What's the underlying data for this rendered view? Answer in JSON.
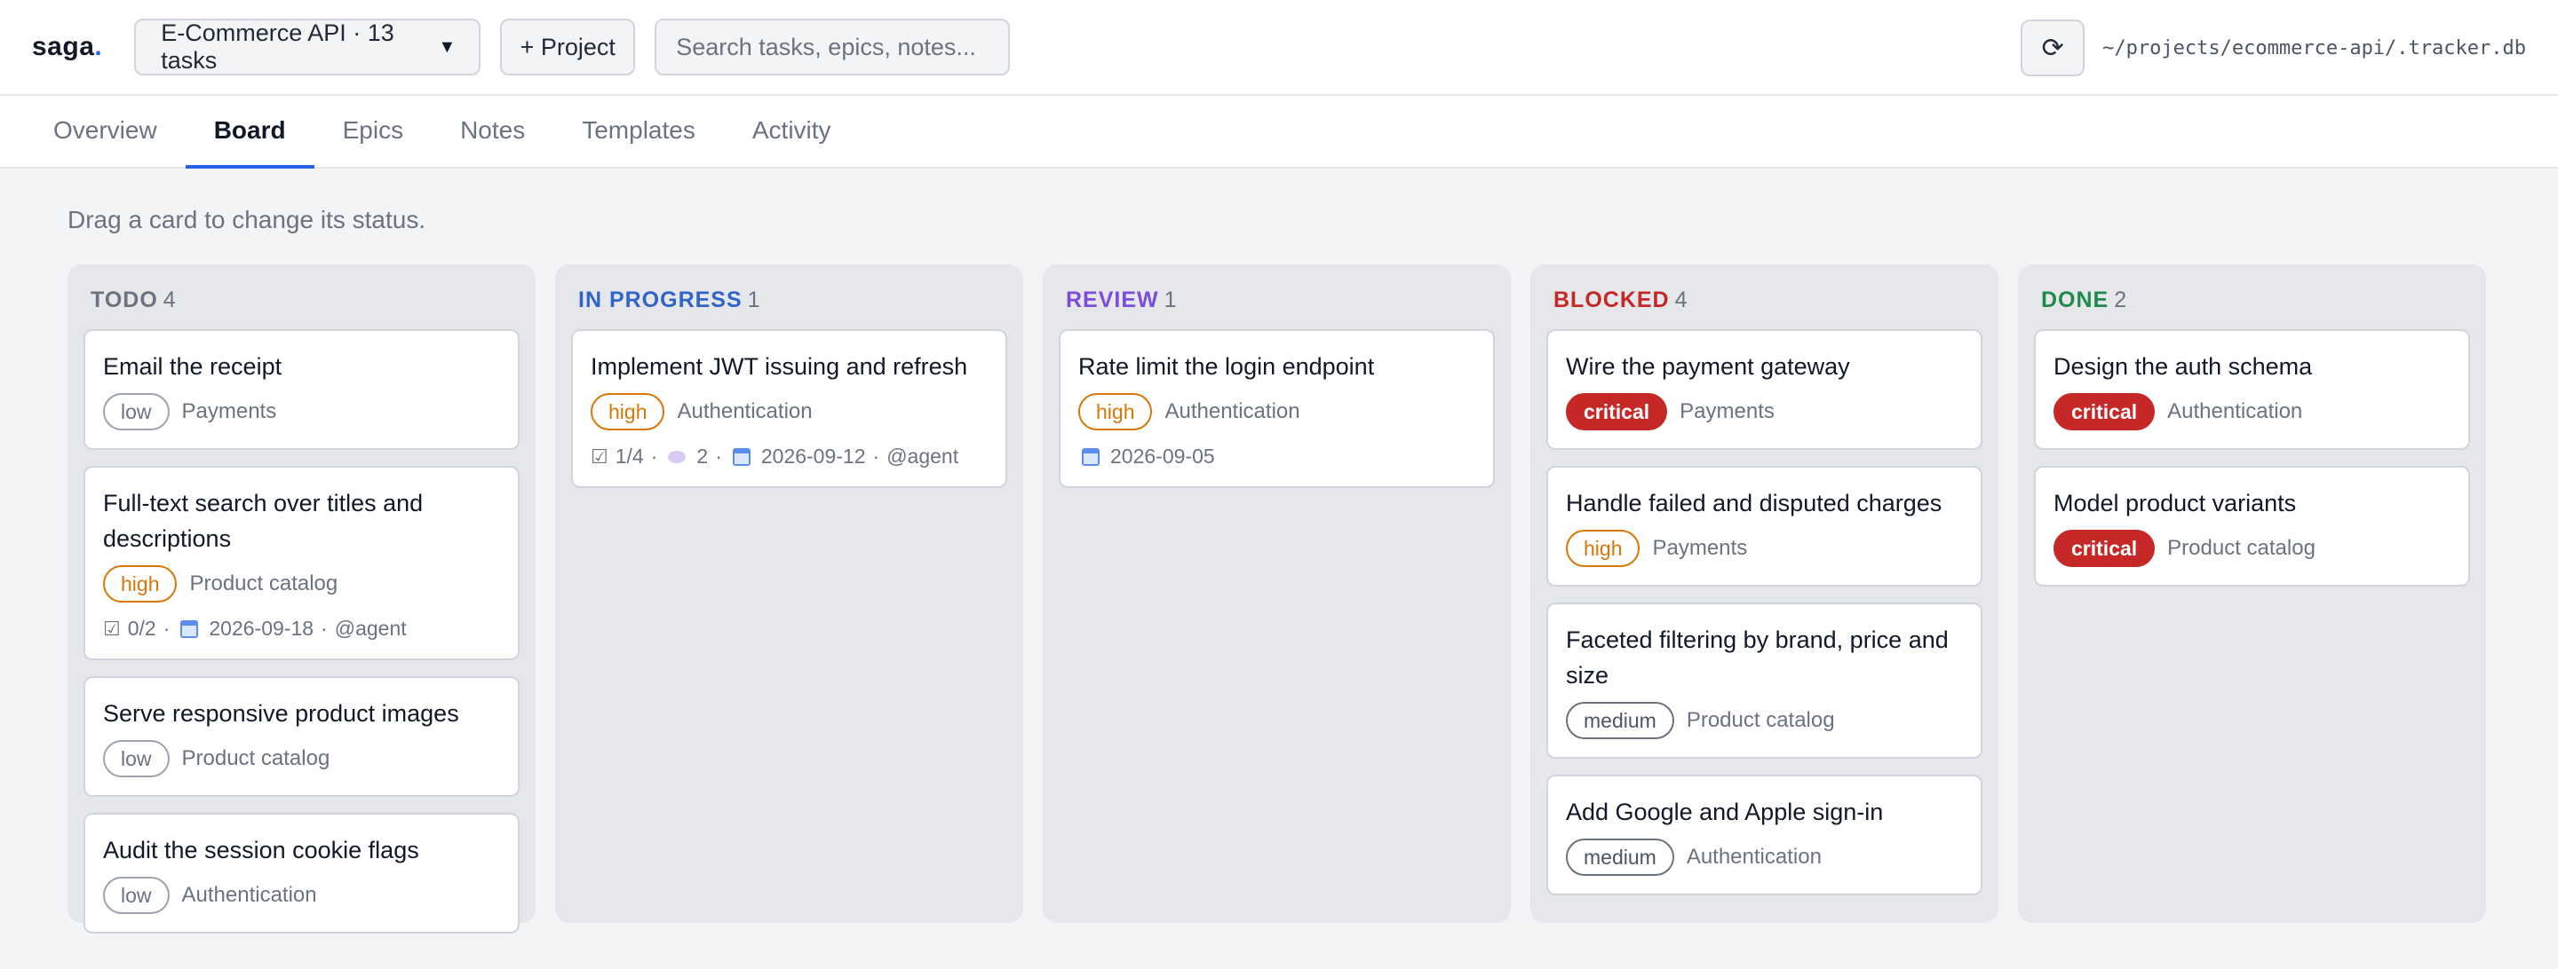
{
  "app": {
    "logo": "saga",
    "logo_dot": ".",
    "project_select": "E-Commerce API · 13 tasks",
    "new_project": "+ Project",
    "search_placeholder": "Search tasks, epics, notes...",
    "refresh_icon": "⟳",
    "db_path": "~/projects/ecommerce-api/.tracker.db"
  },
  "tabs": [
    {
      "label": "Overview"
    },
    {
      "label": "Board",
      "active": true
    },
    {
      "label": "Epics"
    },
    {
      "label": "Notes"
    },
    {
      "label": "Templates"
    },
    {
      "label": "Activity"
    }
  ],
  "hint": "Drag a card to change its status.",
  "colors": {
    "todo": "#6b7280",
    "in_progress": "#2f64c8",
    "review": "#7c4ddb",
    "blocked": "#c62828",
    "done": "#1f8a4c"
  },
  "columns": [
    {
      "title": "TODO",
      "count": "4",
      "cards": [
        {
          "title": "Email the receipt",
          "priority": "low",
          "epic": "Payments"
        },
        {
          "title": "Full-text search over titles and descriptions",
          "priority": "high",
          "epic": "Product catalog",
          "meta": {
            "checks": "0/2",
            "sep1": "·",
            "date": "2026-09-18",
            "sep2": "·",
            "assignee": "@agent"
          }
        },
        {
          "title": "Serve responsive product images",
          "priority": "low",
          "epic": "Product catalog"
        },
        {
          "title": "Audit the session cookie flags",
          "priority": "low",
          "epic": "Authentication"
        }
      ]
    },
    {
      "title": "IN PROGRESS",
      "count": "1",
      "cards": [
        {
          "title": "Implement JWT issuing and refresh",
          "priority": "high",
          "epic": "Authentication",
          "meta": {
            "checks": "1/4",
            "sep1": "·",
            "comments": "2",
            "sep2": "·",
            "date": "2026-09-12",
            "sep3": "·",
            "assignee": "@agent"
          }
        }
      ]
    },
    {
      "title": "REVIEW",
      "count": "1",
      "cards": [
        {
          "title": "Rate limit the login endpoint",
          "priority": "high",
          "epic": "Authentication",
          "meta": {
            "date": "2026-09-05"
          }
        }
      ]
    },
    {
      "title": "BLOCKED",
      "count": "4",
      "cards": [
        {
          "title": "Wire the payment gateway",
          "priority": "critical",
          "epic": "Payments"
        },
        {
          "title": "Handle failed and disputed charges",
          "priority": "high",
          "epic": "Payments"
        },
        {
          "title": "Faceted filtering by brand, price and size",
          "priority": "medium",
          "epic": "Product catalog"
        },
        {
          "title": "Add Google and Apple sign-in",
          "priority": "medium",
          "epic": "Authentication"
        }
      ]
    },
    {
      "title": "DONE",
      "count": "2",
      "cards": [
        {
          "title": "Design the auth schema",
          "priority": "critical",
          "epic": "Authentication"
        },
        {
          "title": "Model product variants",
          "priority": "critical",
          "epic": "Product catalog"
        }
      ]
    }
  ]
}
